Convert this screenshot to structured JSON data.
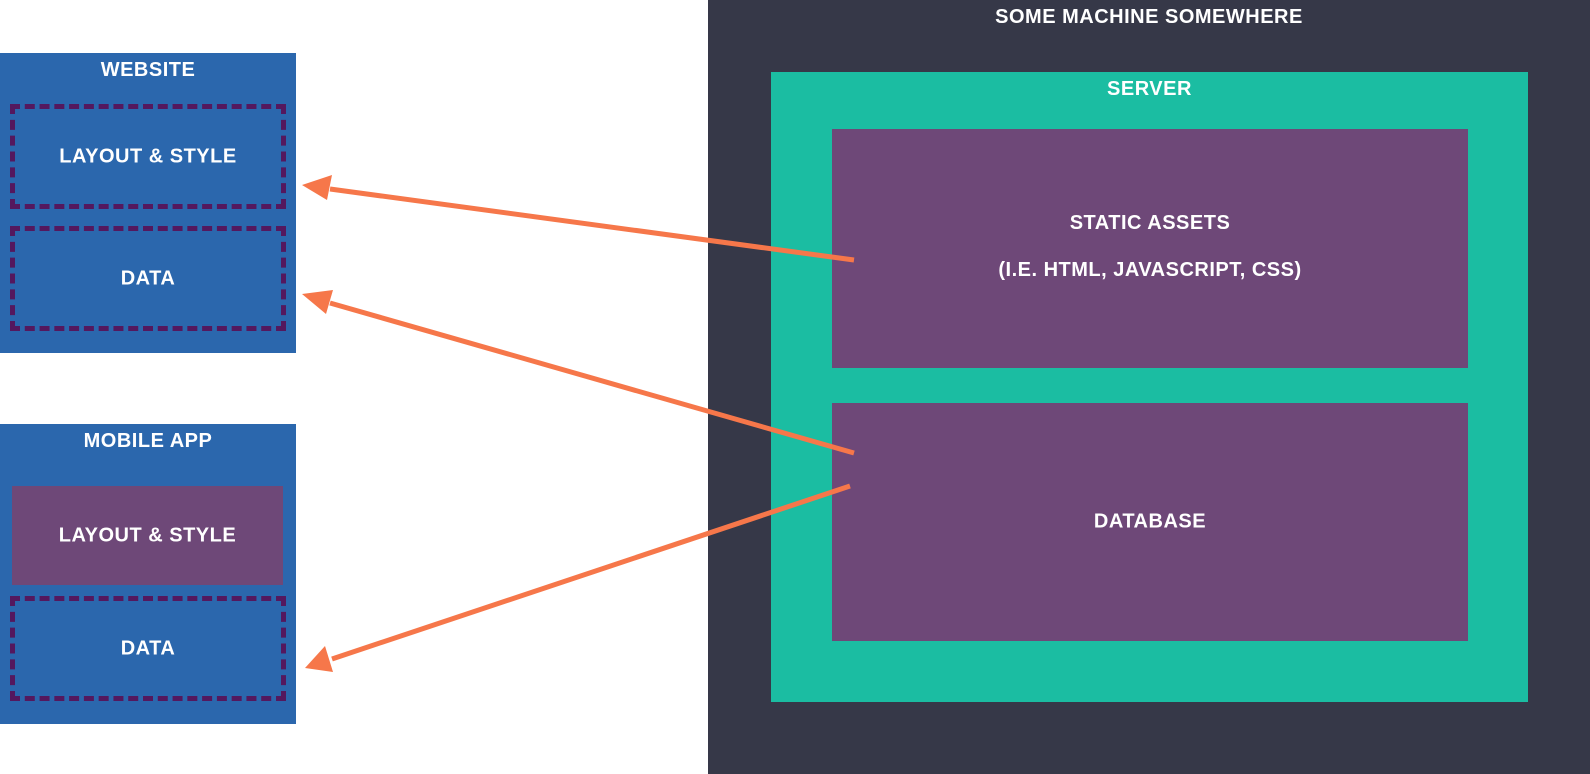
{
  "colors": {
    "client_bg": "#2b67ad",
    "dashed_border": "#54185e",
    "purple_box": "#6e4878",
    "machine_bg": "#363848",
    "server_bg": "#1bbda2",
    "arrow": "#f6774a",
    "text": "#ffffff"
  },
  "website": {
    "title": "WEBSITE",
    "layout_label": "LAYOUT & STYLE",
    "data_label": "DATA"
  },
  "mobile_app": {
    "title": "MOBILE APP",
    "layout_label": "LAYOUT & STYLE",
    "data_label": "DATA"
  },
  "machine": {
    "title": "SOME MACHINE SOMEWHERE",
    "server": {
      "title": "SERVER",
      "static_assets": {
        "title": "STATIC ASSETS",
        "subtitle": "(I.E. HTML, JAVASCRIPT, CSS)"
      },
      "database": {
        "title": "DATABASE"
      }
    }
  },
  "connections": [
    {
      "from": "static-assets",
      "to": "website-layout-style"
    },
    {
      "from": "database",
      "to": "website-data"
    },
    {
      "from": "database",
      "to": "mobile-app-data"
    }
  ]
}
